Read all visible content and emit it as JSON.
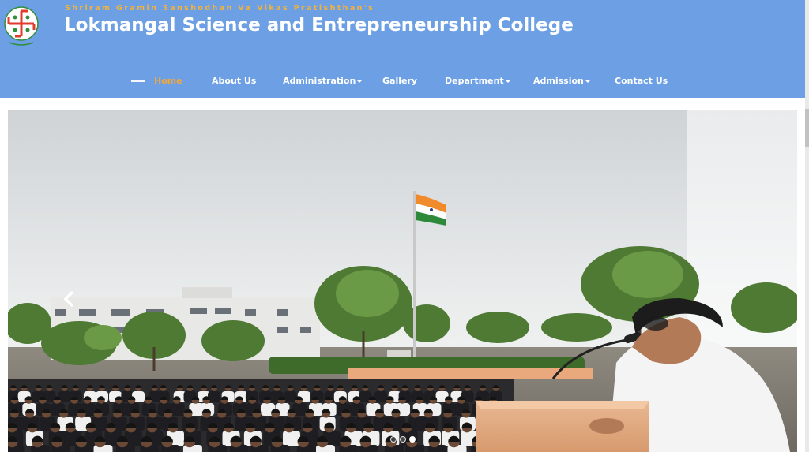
{
  "header": {
    "tagline": "Shriram Gramin Sanshodhan Va Vikas Pratishthan's",
    "title": "Lokmangal Science and Entrepreneurship College",
    "logo_icon": "swastik-emblem-logo",
    "background_color": "#6c9fe4",
    "accent_color": "#f3a83a"
  },
  "nav": {
    "items": [
      {
        "label": "Home",
        "active": true,
        "dropdown": false
      },
      {
        "label": "About Us",
        "active": false,
        "dropdown": false
      },
      {
        "label": "Administration",
        "active": false,
        "dropdown": true
      },
      {
        "label": "Gallery",
        "active": false,
        "dropdown": false
      },
      {
        "label": "Department",
        "active": false,
        "dropdown": true
      },
      {
        "label": "Admission",
        "active": false,
        "dropdown": true
      },
      {
        "label": "Contact Us",
        "active": false,
        "dropdown": false
      }
    ]
  },
  "slider": {
    "prev_icon": "chevron-left-icon",
    "slide_count": 3,
    "active_slide": 3
  }
}
